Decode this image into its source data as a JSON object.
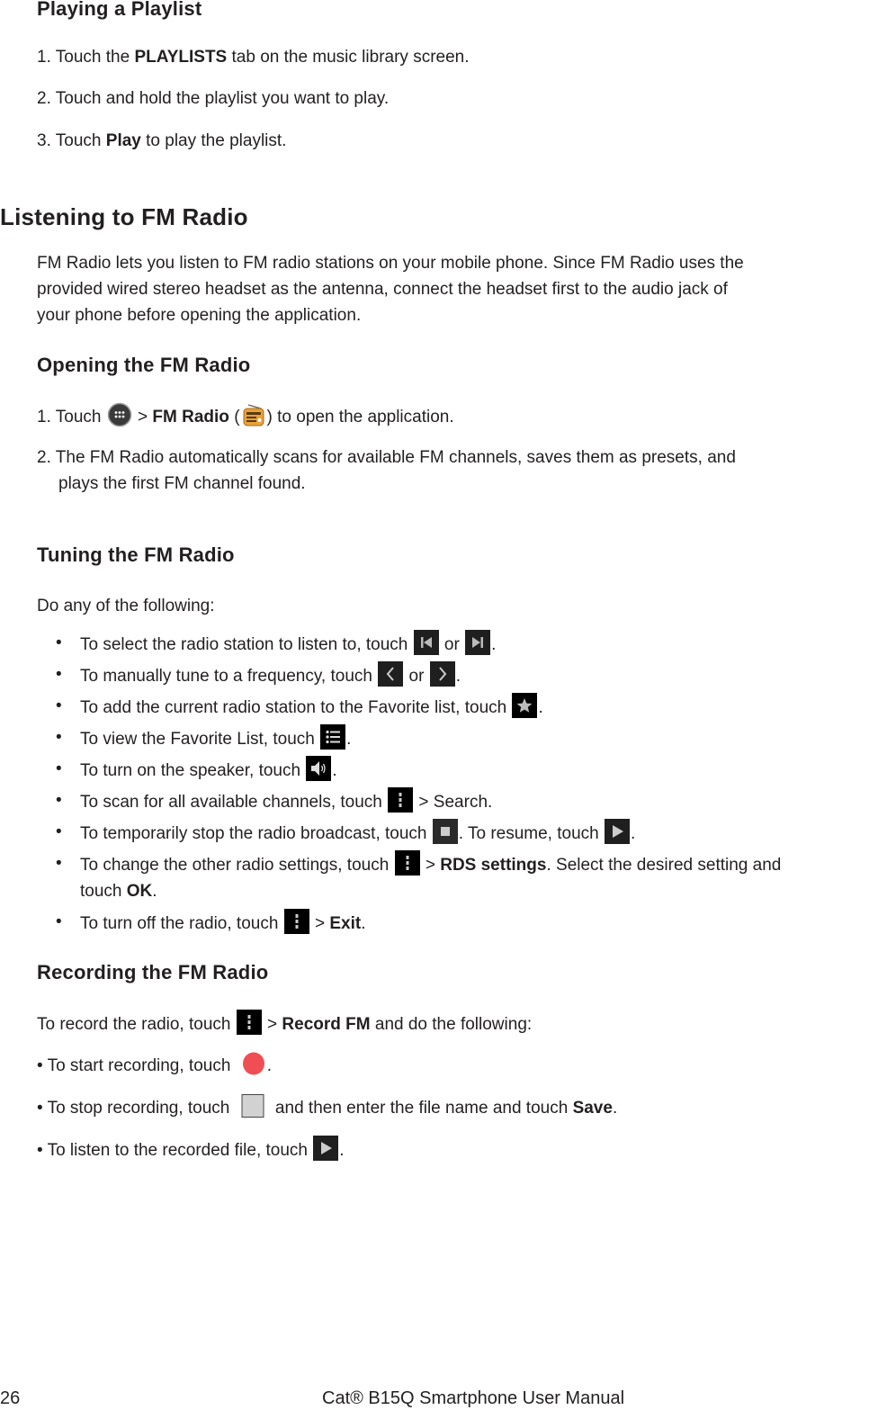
{
  "section_playlist": {
    "title": "Playing a Playlist",
    "steps": [
      {
        "pre": "1. Touch the ",
        "bold": "PLAYLISTS",
        "post": " tab on the music library screen."
      },
      {
        "pre": "2. Touch and hold the playlist you want to play.",
        "bold": "",
        "post": ""
      },
      {
        "pre": "3. Touch ",
        "bold": "Play",
        "post": " to play the playlist."
      }
    ]
  },
  "section_fm": {
    "title": "Listening to FM Radio",
    "intro_lines": [
      "FM Radio lets you listen to FM radio stations on your mobile phone. Since FM Radio uses the",
      "provided wired stereo headset as the antenna, connect the headset first to the audio jack of",
      "your phone before opening the application."
    ]
  },
  "opening": {
    "title": "Opening the FM Radio",
    "step1": {
      "pre": "1. Touch ",
      "mid": " > ",
      "bold": "FM Radio",
      "paren_open": " (",
      "paren_close": ") to open the application."
    },
    "step2_lines": [
      "2. The FM Radio automatically scans for available FM channels, saves them as presets, and",
      "plays the first FM channel found."
    ]
  },
  "tuning": {
    "title": "Tuning the FM Radio",
    "intro": "Do any of the following:",
    "bullet_char": "•",
    "items": [
      {
        "text": "To select the radio station to listen to, touch ",
        "or": " or ",
        "end": "."
      },
      {
        "text": "To manually tune to a frequency, touch ",
        "or": " or ",
        "end": "."
      },
      {
        "text": "To add the current radio station to the Favorite list, touch ",
        "end": "."
      },
      {
        "text": "To view the Favorite List, touch ",
        "end": "."
      },
      {
        "text": "To turn on the speaker, touch ",
        "end": "."
      },
      {
        "text": "To scan for all available channels, touch ",
        "post": " > Search."
      },
      {
        "text": "To temporarily stop the radio broadcast, touch ",
        "mid": ". To resume, touch ",
        "end": "."
      },
      {
        "text": "To change the other radio settings, touch ",
        "gt": " > ",
        "bold": "RDS settings",
        "post": ". Select the desired setting and",
        "line2_pre": "touch ",
        "line2_bold": "OK",
        "line2_end": "."
      },
      {
        "text": "To turn off the radio, touch ",
        "gt": " > ",
        "bold": "Exit",
        "end": "."
      }
    ]
  },
  "recording": {
    "title": "Recording the FM Radio",
    "intro": {
      "pre": "To record the radio, touch ",
      "gt": " > ",
      "bold": "Record FM",
      "post": " and do the following:"
    },
    "items": [
      {
        "text": "• To start recording, touch ",
        "end": "."
      },
      {
        "text": "• To stop recording, touch ",
        "post": " and then enter the file name and touch ",
        "bold": "Save",
        "end": "."
      },
      {
        "text": "• To listen to the recorded file, touch ",
        "end": "."
      }
    ]
  },
  "icons": {
    "record_color": "#f04e55",
    "radio_app_color": "#e8a23a",
    "icon_bg": "#1f1f1f"
  },
  "footer": {
    "page_number": "26",
    "title": "Cat® B15Q Smartphone User Manual"
  }
}
